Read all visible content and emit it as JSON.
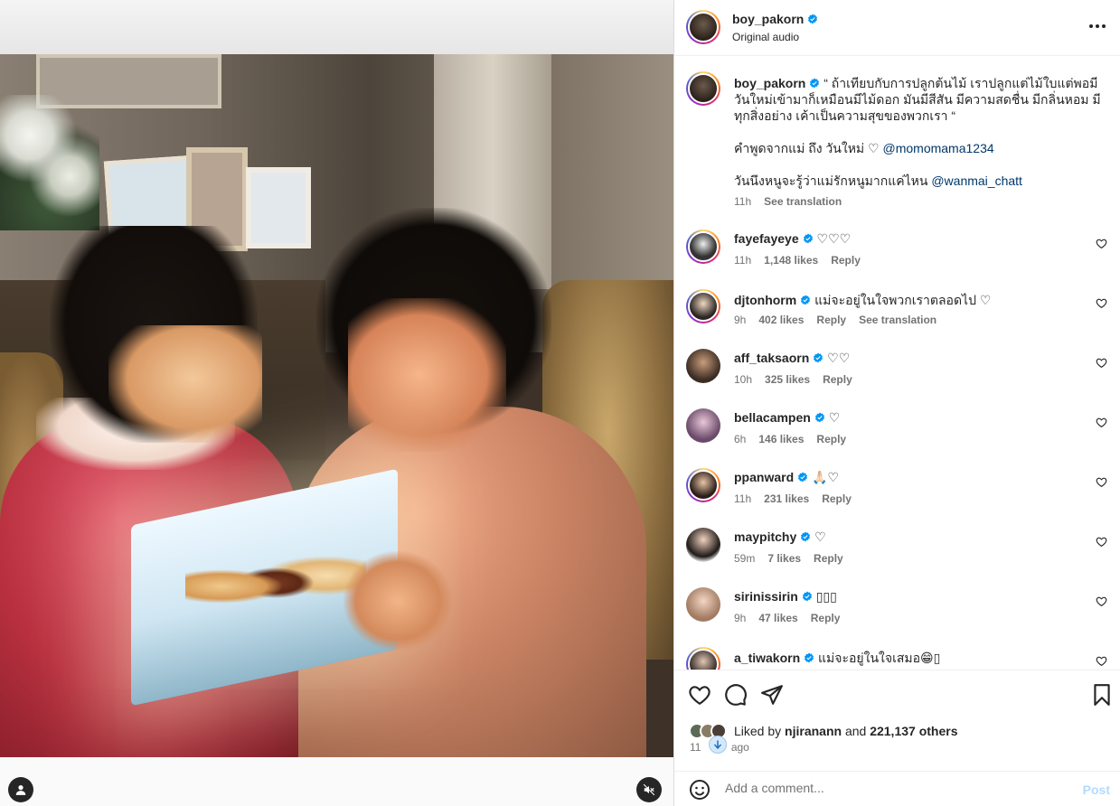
{
  "post": {
    "username": "boy_pakorn",
    "audio": "Original audio"
  },
  "caption": {
    "username": "boy_pakorn",
    "text": "“ ถ้าเทียบกับการปลูกต้นไม้ เราปลูกแต่ไม้ใบแต่พอมีวันใหม่เข้ามาก็เหมือนมีไม้ดอก มันมีสีสัน มีความสดชื่น มีกลิ่นหอม มีทุกสิ่งอย่าง เค้าเป็นความสุขของพวกเรา “",
    "line2_prefix": "คำพูดจากแม่ ถึง วันใหม่ ♡",
    "line2_mention": "@momomama1234",
    "line3_prefix": "วันนึงหนูจะรู้ว่าแม่รักหนูมากแค่ไหน",
    "line3_mention": "@wanmai_chatt",
    "time": "11h",
    "translate": "See translation"
  },
  "comments": [
    {
      "user": "fayefayeye",
      "text": "♡♡♡",
      "time": "11h",
      "likes": "1,148 likes",
      "reply": "Reply",
      "extra": ""
    },
    {
      "user": "djtonhorm",
      "text": "แม่จะอยู่ในใจพวกเราตลอดไป ♡",
      "time": "9h",
      "likes": "402 likes",
      "reply": "Reply",
      "extra": "See translation"
    },
    {
      "user": "aff_taksaorn",
      "text": "♡♡",
      "time": "10h",
      "likes": "325 likes",
      "reply": "Reply",
      "extra": ""
    },
    {
      "user": "bellacampen",
      "text": "♡",
      "time": "6h",
      "likes": "146 likes",
      "reply": "Reply",
      "extra": ""
    },
    {
      "user": "ppanward",
      "text": "🙏🏻♡",
      "time": "11h",
      "likes": "231 likes",
      "reply": "Reply",
      "extra": ""
    },
    {
      "user": "maypitchy",
      "text": "♡",
      "time": "59m",
      "likes": "7 likes",
      "reply": "Reply",
      "extra": ""
    },
    {
      "user": "sirinissirin",
      "text": "▯▯▯",
      "time": "9h",
      "likes": "47 likes",
      "reply": "Reply",
      "extra": ""
    },
    {
      "user": "a_tiwakorn",
      "text": "แม่จะอยู่ในใจเสมอ😁▯",
      "time": "",
      "likes": "",
      "reply": "",
      "extra": ""
    }
  ],
  "likes": {
    "prefix": "Liked by",
    "user": "njiranann",
    "and": "and",
    "count": "221,137 others"
  },
  "time_ago": {
    "left": "11",
    "right": "ago"
  },
  "add_comment": {
    "placeholder": "Add a comment...",
    "post_label": "Post"
  },
  "colors": {
    "verified": "#0095f6",
    "link": "#00376b",
    "post_disabled": "#b3dbff"
  },
  "icons": {
    "like": "heart-icon",
    "comment": "comment-bubble-icon",
    "share": "paper-plane-icon",
    "save": "bookmark-icon",
    "emoji": "emoji-icon",
    "more": "more-options-icon",
    "mute": "muted-speaker-icon",
    "tags": "user-tag-icon"
  }
}
